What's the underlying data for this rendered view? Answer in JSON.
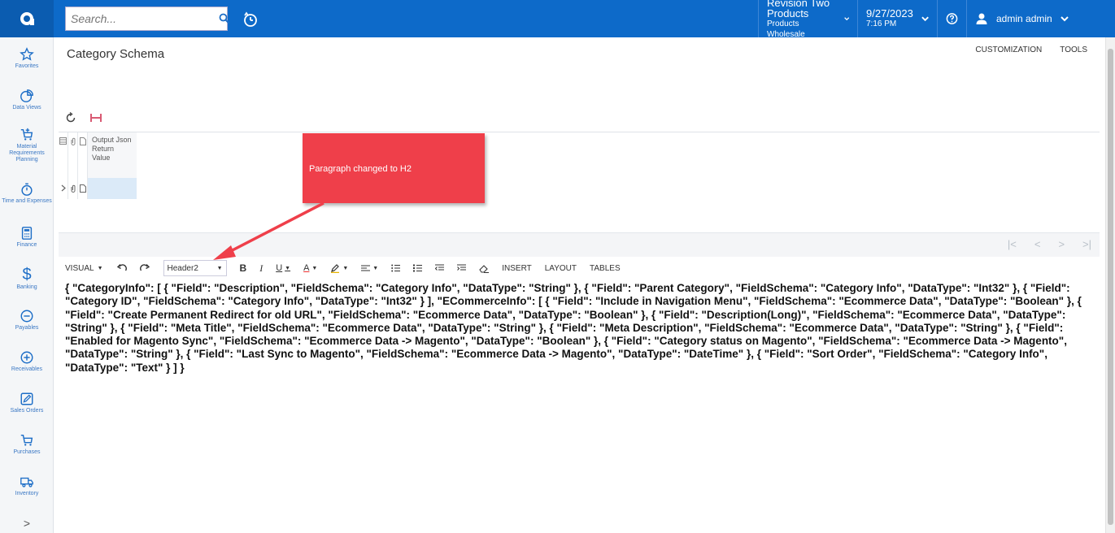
{
  "header": {
    "search_placeholder": "Search...",
    "company": {
      "line1": "Revision Two Products",
      "line2": "Products Wholesale"
    },
    "datetime": {
      "date": "9/27/2023",
      "time": "7:16 PM"
    },
    "user": "admin admin"
  },
  "sidebar": {
    "items": [
      {
        "label": "Favorites",
        "icon": "star-icon"
      },
      {
        "label": "Data Views",
        "icon": "pie-chart-icon"
      },
      {
        "label": "Material Requirements Planning",
        "icon": "cart-plus-icon"
      },
      {
        "label": "Time and Expenses",
        "icon": "stopwatch-icon"
      },
      {
        "label": "Finance",
        "icon": "calculator-icon"
      },
      {
        "label": "Banking",
        "icon": "dollar-icon"
      },
      {
        "label": "Payables",
        "icon": "minus-circle-icon"
      },
      {
        "label": "Receivables",
        "icon": "plus-circle-icon"
      },
      {
        "label": "Sales Orders",
        "icon": "edit-icon"
      },
      {
        "label": "Purchases",
        "icon": "cart-icon"
      },
      {
        "label": "Inventory",
        "icon": "truck-icon"
      }
    ],
    "expand": ">"
  },
  "page": {
    "title": "Category Schema",
    "links": [
      "CUSTOMIZATION",
      "TOOLS"
    ]
  },
  "grid": {
    "columns": [
      "Output Json Return Value"
    ]
  },
  "toolbar": {
    "visual": "VISUAL",
    "format": "Header2",
    "insert": "INSERT",
    "layout": "LAYOUT",
    "tables": "TABLES"
  },
  "editor": {
    "content": "{ \"CategoryInfo\": [ { \"Field\": \"Description\", \"FieldSchema\": \"Category Info\", \"DataType\": \"String\" }, { \"Field\": \"Parent Category\", \"FieldSchema\": \"Category Info\", \"DataType\": \"Int32\" }, { \"Field\": \"Category ID\", \"FieldSchema\": \"Category Info\", \"DataType\": \"Int32\" } ], \"ECommerceInfo\": [ { \"Field\": \"Include in Navigation Menu\", \"FieldSchema\": \"Ecommerce Data\", \"DataType\": \"Boolean\" }, { \"Field\": \"Create Permanent Redirect for old URL\", \"FieldSchema\": \"Ecommerce Data\", \"DataType\": \"Boolean\" }, { \"Field\": \"Description(Long)\", \"FieldSchema\": \"Ecommerce Data\", \"DataType\": \"String\" }, { \"Field\": \"Meta Title\", \"FieldSchema\": \"Ecommerce Data\", \"DataType\": \"String\" }, { \"Field\": \"Meta Description\", \"FieldSchema\": \"Ecommerce Data\", \"DataType\": \"String\" }, { \"Field\": \"Enabled for Magento Sync\", \"FieldSchema\": \"Ecommerce Data -> Magento\", \"DataType\": \"Boolean\" }, { \"Field\": \"Category status on Magento\", \"FieldSchema\": \"Ecommerce Data -> Magento\", \"DataType\": \"String\" }, { \"Field\": \"Last Sync to Magento\", \"FieldSchema\": \"Ecommerce Data -> Magento\", \"DataType\": \"DateTime\" }, { \"Field\": \"Sort Order\", \"FieldSchema\": \"Category Info\", \"DataType\": \"Text\" } ] }"
  },
  "callout": {
    "text": "Paragraph changed to H2"
  },
  "colors": {
    "brand": "#0d6ac9",
    "callout": "#ef3f4a",
    "nav_icon": "#1d6ec7"
  }
}
